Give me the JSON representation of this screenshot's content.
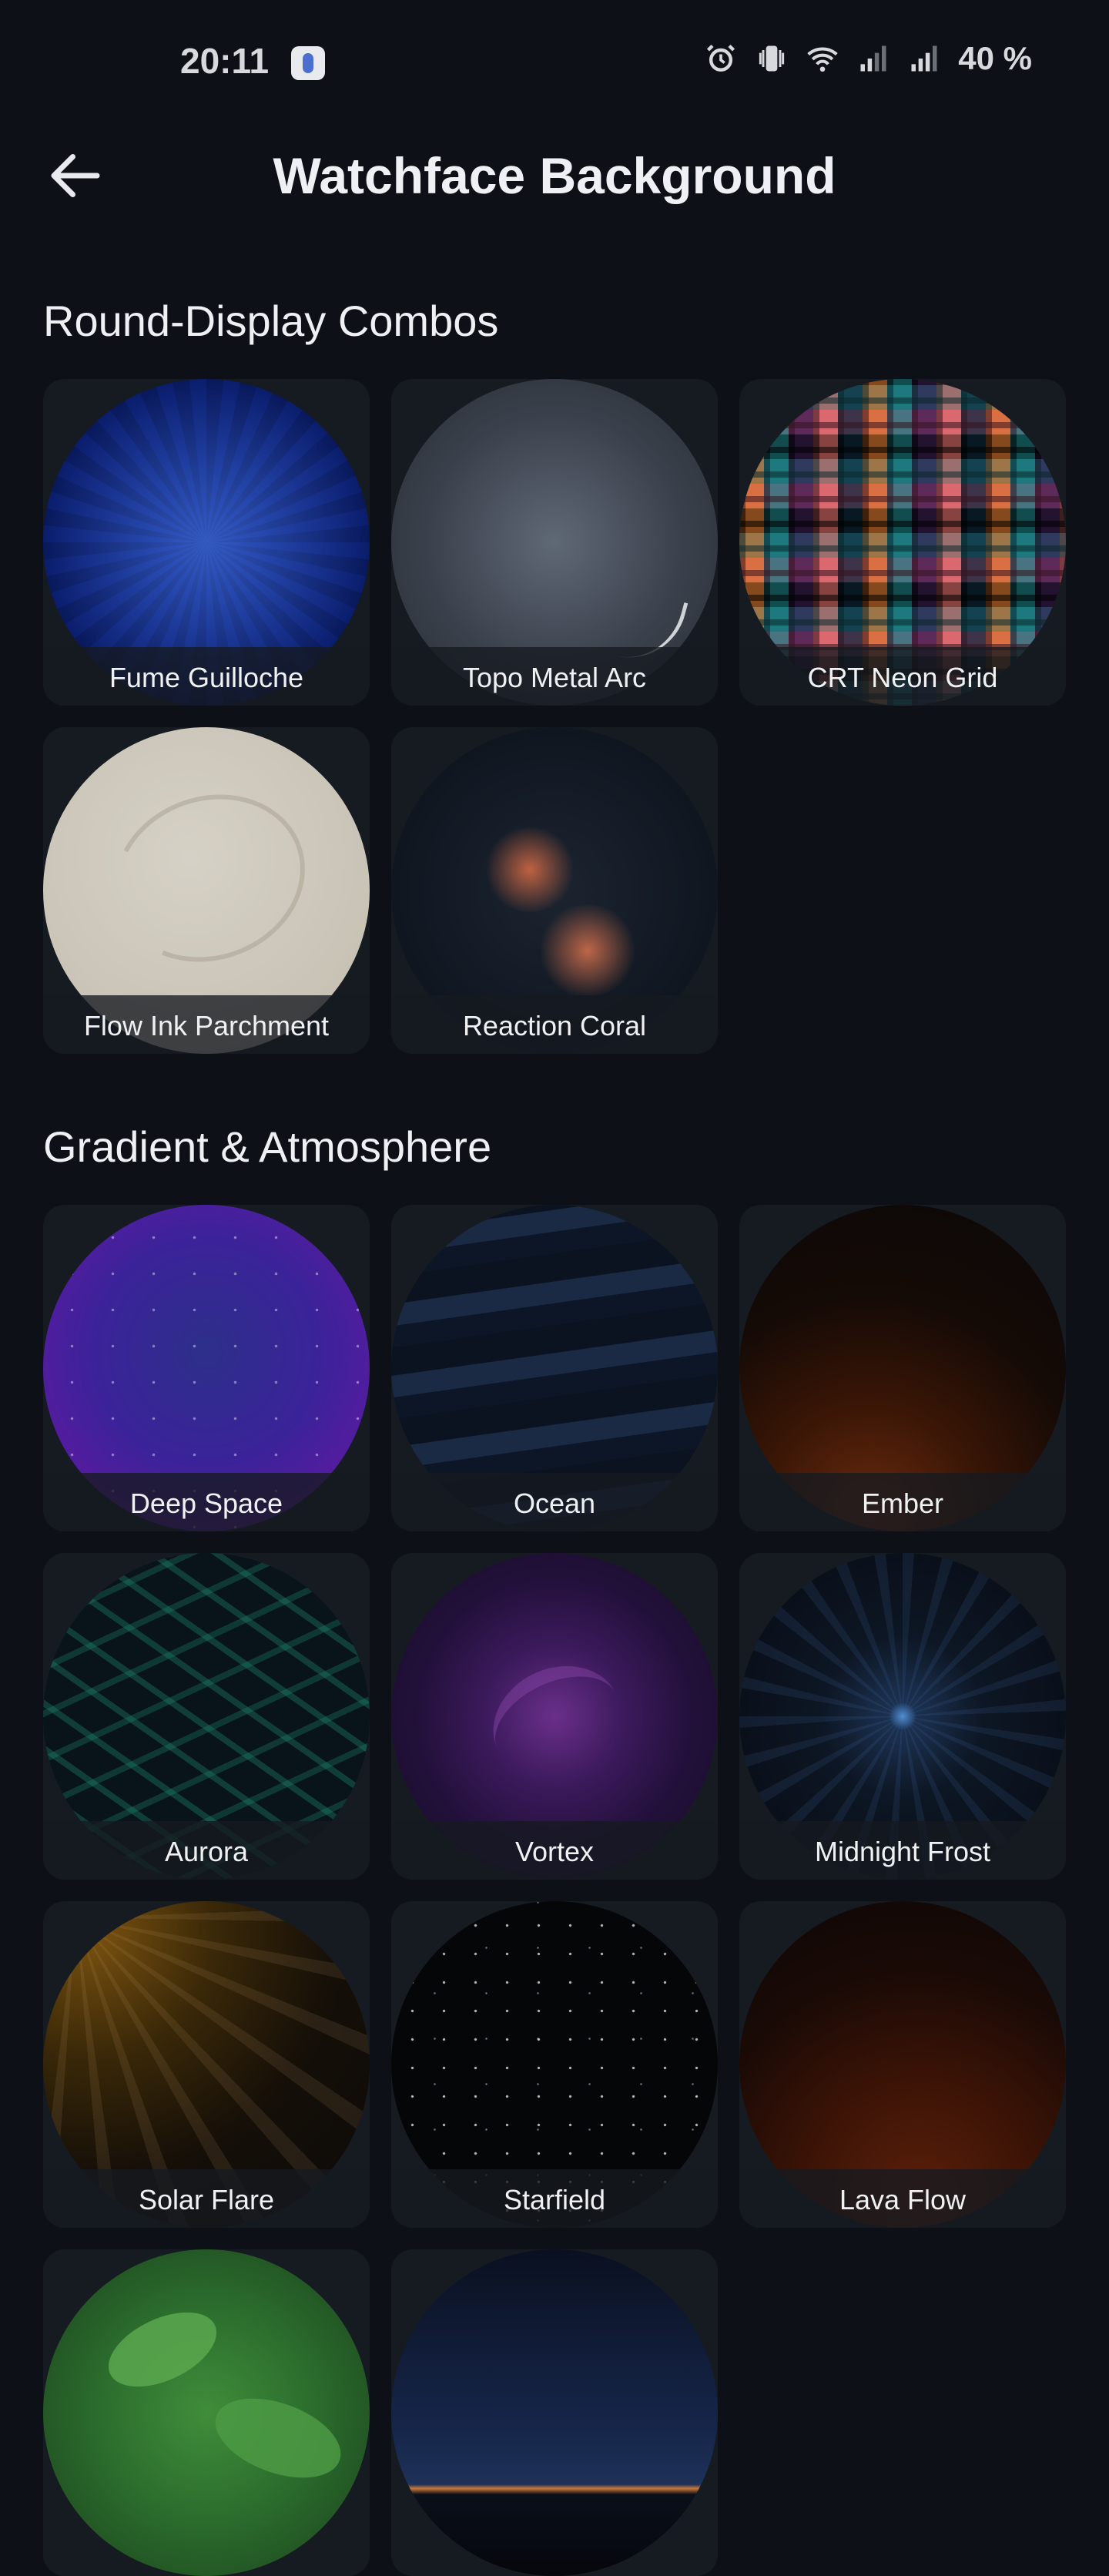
{
  "status_bar": {
    "time": "20:11",
    "battery": "40 %"
  },
  "header": {
    "title": "Watchface Background",
    "back_icon": "arrow-left-icon"
  },
  "sections": [
    {
      "title": "Round-Display Combos",
      "items": [
        {
          "label": "Fume Guilloche"
        },
        {
          "label": "Topo Metal Arc"
        },
        {
          "label": "CRT Neon Grid"
        },
        {
          "label": "Flow Ink Parchment"
        },
        {
          "label": "Reaction Coral"
        }
      ]
    },
    {
      "title": "Gradient & Atmosphere",
      "items": [
        {
          "label": "Deep Space"
        },
        {
          "label": "Ocean"
        },
        {
          "label": "Ember"
        },
        {
          "label": "Aurora"
        },
        {
          "label": "Vortex"
        },
        {
          "label": "Midnight Frost"
        },
        {
          "label": "Solar Flare"
        },
        {
          "label": "Starfield"
        },
        {
          "label": "Lava Flow"
        },
        {
          "label": ""
        },
        {
          "label": ""
        }
      ]
    }
  ]
}
